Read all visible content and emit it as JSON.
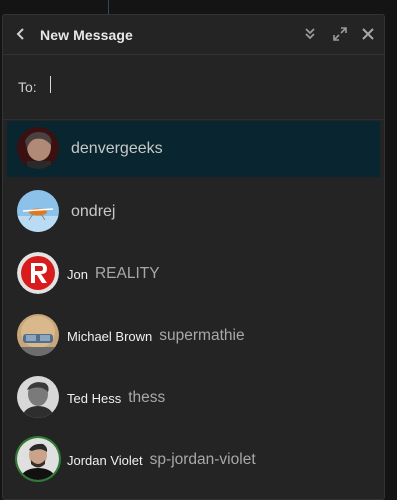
{
  "header": {
    "title": "New Message"
  },
  "to": {
    "label": "To:"
  },
  "contacts": [
    {
      "fullname": "",
      "username": "denvergeeks"
    },
    {
      "fullname": "",
      "username": "ondrej"
    },
    {
      "fullname": "Jon",
      "username": "REALITY"
    },
    {
      "fullname": "Michael Brown",
      "username": "supermathie"
    },
    {
      "fullname": "Ted Hess",
      "username": "thess"
    },
    {
      "fullname": "Jordan Violet",
      "username": "sp-jordan-violet"
    }
  ],
  "colors": {
    "selected_row": "#082530",
    "panel": "#242424",
    "background": "#141414"
  }
}
